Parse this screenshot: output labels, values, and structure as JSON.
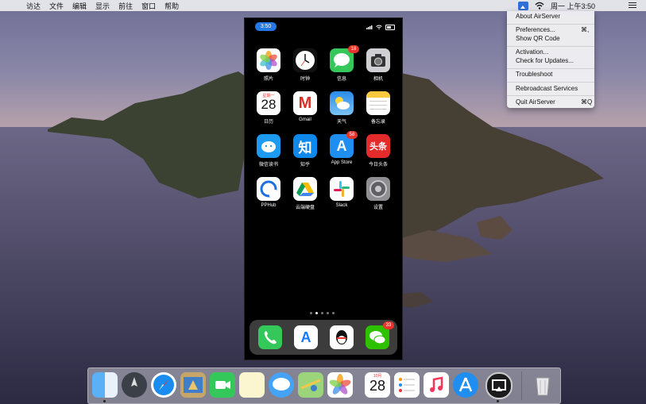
{
  "menubar": {
    "apple": "",
    "items": [
      "访达",
      "文件",
      "编辑",
      "显示",
      "前往",
      "窗口",
      "帮助"
    ],
    "clock": "周一 上午3:50",
    "icons": [
      "airserver-icon",
      "wifi-icon",
      "notification-list-icon"
    ]
  },
  "airserver_menu": {
    "items": [
      {
        "label": "About AirServer",
        "shortcut": ""
      },
      {
        "label": "Preferences...",
        "shortcut": "⌘,"
      },
      {
        "label": "Show QR Code",
        "shortcut": ""
      },
      {
        "label": "Activation...",
        "shortcut": ""
      },
      {
        "label": "Check for Updates...",
        "shortcut": ""
      },
      {
        "label": "Troubleshoot",
        "shortcut": ""
      },
      {
        "label": "Rebroadcast Services",
        "shortcut": ""
      },
      {
        "label": "Quit AirServer",
        "shortcut": "⌘Q"
      }
    ]
  },
  "phone": {
    "status_time": "3:50",
    "apps": [
      {
        "label": "照片",
        "icon": "photos-icon",
        "badge": ""
      },
      {
        "label": "时钟",
        "icon": "clock-icon",
        "badge": ""
      },
      {
        "label": "信息",
        "icon": "messages-icon",
        "badge": "18"
      },
      {
        "label": "相机",
        "icon": "camera-icon",
        "badge": ""
      },
      {
        "label": "日历",
        "icon": "calendar-icon",
        "badge": "",
        "glyph": "28",
        "sub": "星期一"
      },
      {
        "label": "Gmail",
        "icon": "gmail-icon",
        "badge": "",
        "glyph": "M"
      },
      {
        "label": "天气",
        "icon": "weather-icon",
        "badge": ""
      },
      {
        "label": "备忘录",
        "icon": "notes-icon",
        "badge": ""
      },
      {
        "label": "微信读书",
        "icon": "wechat-read-icon",
        "badge": ""
      },
      {
        "label": "知乎",
        "icon": "zhihu-icon",
        "badge": "",
        "glyph": "知"
      },
      {
        "label": "App Store",
        "icon": "app-store-icon",
        "badge": "58",
        "glyph": "A"
      },
      {
        "label": "今日头条",
        "icon": "toutiao-icon",
        "badge": "",
        "glyph": "头条"
      },
      {
        "label": "PPHub",
        "icon": "pphub-icon",
        "badge": ""
      },
      {
        "label": "云端硬盘",
        "icon": "google-drive-icon",
        "badge": ""
      },
      {
        "label": "Slack",
        "icon": "slack-icon",
        "badge": ""
      },
      {
        "label": "设置",
        "icon": "settings-icon",
        "badge": ""
      }
    ],
    "dock": [
      {
        "icon": "phone-icon",
        "badge": ""
      },
      {
        "icon": "alipay-icon",
        "badge": "",
        "glyph": "A"
      },
      {
        "icon": "qq-icon",
        "badge": ""
      },
      {
        "icon": "wechat-icon",
        "badge": "33"
      }
    ],
    "pages": 5,
    "current_page": 2
  },
  "mac_dock": [
    {
      "icon": "finder-icon",
      "running": true
    },
    {
      "icon": "launchpad-icon",
      "running": false
    },
    {
      "icon": "safari-icon",
      "running": false
    },
    {
      "icon": "mail-icon",
      "running": false
    },
    {
      "icon": "facetime-icon",
      "running": false
    },
    {
      "icon": "notes-icon",
      "running": false
    },
    {
      "icon": "messages-icon",
      "running": false
    },
    {
      "icon": "maps-icon",
      "running": false
    },
    {
      "icon": "photos-icon",
      "running": false
    },
    {
      "icon": "calendar-icon",
      "running": false,
      "glyph": "28",
      "sub": "10月"
    },
    {
      "icon": "reminders-icon",
      "running": false
    },
    {
      "icon": "music-icon",
      "running": false
    },
    {
      "icon": "app-store-icon",
      "running": false
    },
    {
      "icon": "airserver-icon",
      "running": true
    },
    {
      "icon": "trash-icon",
      "running": false
    }
  ]
}
